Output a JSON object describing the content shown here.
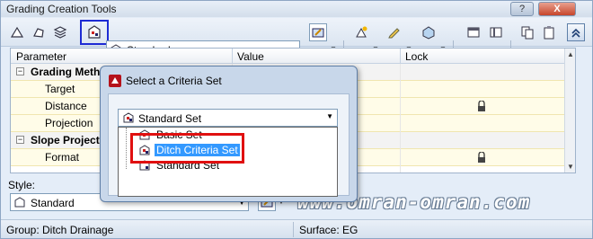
{
  "window": {
    "title": "Grading Creation Tools",
    "help_label": "?",
    "close_label": "X"
  },
  "toolbar": {
    "group_combo_value": "Standard",
    "icons": [
      "set-grading-group-icon",
      "grading-criteria-icon",
      "layers-icon",
      "criteria-set-icon",
      "target-surface-icon",
      "create-grading-icon",
      "edit-grading-icon",
      "elevation-icon",
      "panel-icon",
      "table-icon",
      "copy-icon",
      "clipboard-icon",
      "collapse-icon"
    ]
  },
  "grid": {
    "columns": [
      "Parameter",
      "Value",
      "Lock"
    ],
    "rows": [
      {
        "label": "Grading Method",
        "type": "category",
        "expand": "−"
      },
      {
        "label": "Target",
        "type": "item",
        "locked": false
      },
      {
        "label": "Distance",
        "type": "item",
        "locked": true
      },
      {
        "label": "Projection",
        "type": "item",
        "locked": false
      },
      {
        "label": "Slope Projection",
        "type": "category",
        "expand": "−"
      },
      {
        "label": "Format",
        "type": "item",
        "locked": true
      }
    ]
  },
  "style": {
    "label": "Style:",
    "value": "Standard"
  },
  "status": {
    "group": "Group: Ditch Drainage",
    "surface": "Surface: EG"
  },
  "dialog": {
    "title": "Select a Criteria Set",
    "selected": "Standard Set",
    "options": [
      "Basic Set",
      "Ditch Criteria Set",
      "Standard Set"
    ],
    "highlighted": "Ditch Criteria Set"
  },
  "watermark": "www.omran-omran.com"
}
